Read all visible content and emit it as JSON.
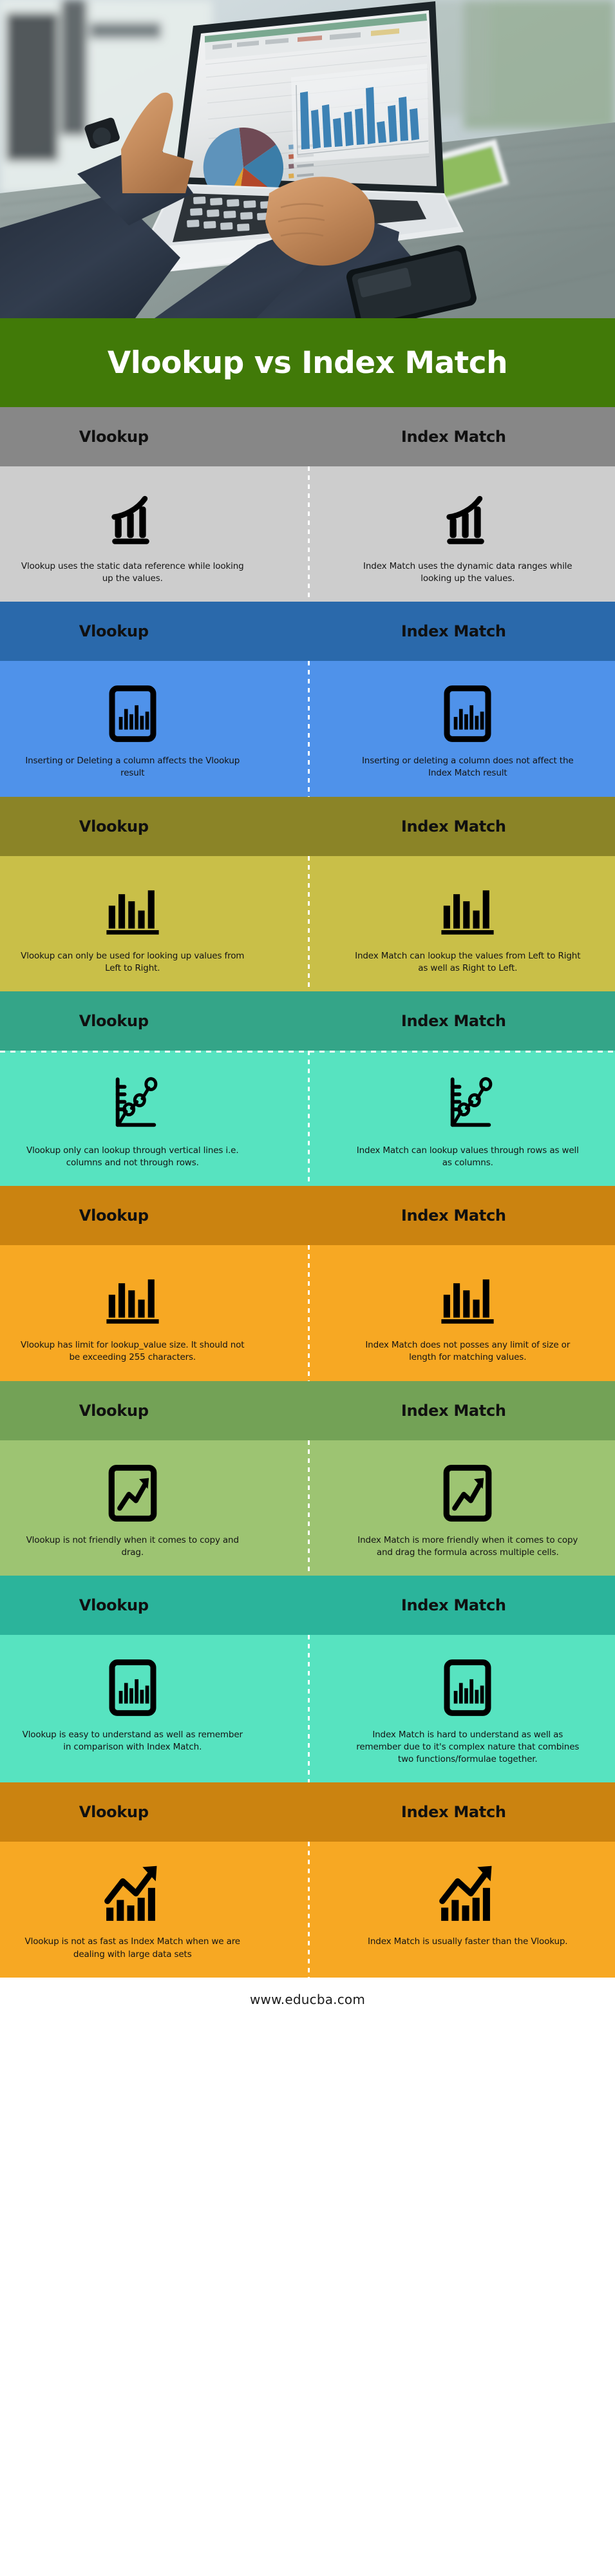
{
  "hero": {
    "alt": "businessman-working-on-laptop-with-excel-charts-photo",
    "scene_items": [
      "laptop-with-spreadsheet",
      "pie-chart-on-screen",
      "bar-chart-on-screen",
      "hand-on-keyboard",
      "wristwatch",
      "tablet",
      "smartphone",
      "wooden-table"
    ]
  },
  "title": "Vlookup vs Index Match",
  "columns": {
    "left": "Vlookup",
    "right": "Index Match"
  },
  "colors": {
    "title_banner": "#417a08",
    "footer_bg": "#ffffff",
    "divider": "#ffffff"
  },
  "rows": [
    {
      "header_bg": "#878787",
      "body_bg": "#cdcdcd",
      "icon": "growth-bar-chart-icon",
      "left_header": "Vlookup",
      "right_header": "Index Match",
      "left_text": "Vlookup uses the static data reference while looking up the values.",
      "right_text": "Index Match uses the dynamic data ranges while looking up the values."
    },
    {
      "header_bg": "#2a69ab",
      "body_bg": "#4f92ea",
      "icon": "framed-bar-chart-icon",
      "left_header": "Vlookup",
      "right_header": "Index Match",
      "left_text": "Inserting or Deleting a column affects the Vlookup result",
      "right_text": "Inserting or deleting a column does not affect the Index Match result"
    },
    {
      "header_bg": "#8b8427",
      "body_bg": "#c9bf48",
      "icon": "plain-bar-chart-icon",
      "left_header": "Vlookup",
      "right_header": "Index Match",
      "left_text": "Vlookup can only be used for looking up values from Left to Right.",
      "right_text": "Index Match can lookup the values from Left to Right as well as Right to Left."
    },
    {
      "header_bg": "#34a588",
      "body_bg": "#57e3c0",
      "icon": "line-plot-axis-icon",
      "left_header": "Vlookup",
      "right_header": "Index Match",
      "left_text": "Vlookup only can lookup through vertical lines i.e. columns and not through rows.",
      "right_text": "Index Match can lookup values through rows as well as columns."
    },
    {
      "header_bg": "#cb8310",
      "body_bg": "#f7a823",
      "icon": "plain-bar-chart-icon",
      "left_header": "Vlookup",
      "right_header": "Index Match",
      "left_text": "Vlookup has limit for lookup_value size. It should not be exceeding 255 characters.",
      "right_text": "Index Match does not posses any limit of size or length for matching values."
    },
    {
      "header_bg": "#73a256",
      "body_bg": "#9dc472",
      "icon": "framed-trend-arrow-icon",
      "left_header": "Vlookup",
      "right_header": "Index Match",
      "left_text": "Vlookup is not friendly when it comes to copy and drag.",
      "right_text": "Index Match is more friendly when it comes to copy and drag the formula across multiple cells."
    },
    {
      "header_bg": "#2bb49b",
      "body_bg": "#57e3c0",
      "icon": "framed-bar-chart-icon",
      "left_header": "Vlookup",
      "right_header": "Index Match",
      "left_text": "Vlookup is easy to understand as well as remember in comparison with Index Match.",
      "right_text": "Index Match is hard to understand as well as remember due to it's complex nature that combines two functions/formulae together."
    },
    {
      "header_bg": "#cb8310",
      "body_bg": "#f7a823",
      "icon": "trend-arrow-bars-icon",
      "left_header": "Vlookup",
      "right_header": "Index Match",
      "left_text": "Vlookup is not as fast as Index Match when we are dealing with large data sets",
      "right_text": "Index Match is usually faster than the Vlookup."
    }
  ],
  "footer": {
    "url": "www.educba.com"
  }
}
